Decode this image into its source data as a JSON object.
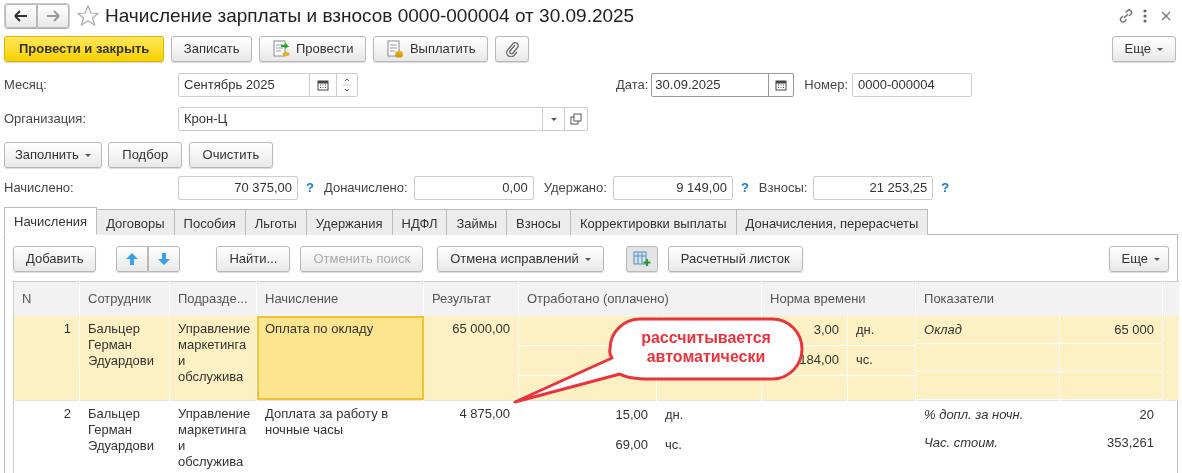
{
  "window": {
    "title": "Начисление зарплаты и взносов 0000-000004 от 30.09.2025",
    "favorite": false
  },
  "toolbar": {
    "buttons": [
      {
        "label": "Провести и закрыть",
        "kind": "primary"
      },
      {
        "label": "Записать",
        "kind": "plain"
      },
      {
        "label": "Провести",
        "kind": "post"
      },
      {
        "label": "Выплатить",
        "kind": "pay"
      },
      {
        "kind": "attach"
      }
    ],
    "more": "Еще"
  },
  "header": {
    "month": {
      "label": "Месяц:",
      "value": "Сентябрь 2025"
    },
    "date": {
      "label": "Дата:",
      "value": "30.09.2025"
    },
    "number": {
      "label": "Номер:",
      "value": "0000-000004"
    },
    "organization": {
      "label": "Организация:",
      "value": "Крон-Ц"
    }
  },
  "fill_buttons": [
    {
      "label": "Заполнить",
      "dropdown": true
    },
    {
      "label": "Подбор",
      "dropdown": false
    },
    {
      "label": "Очистить",
      "dropdown": false
    }
  ],
  "totals": [
    {
      "label": "Начислено:",
      "value": "70 375,00",
      "help": "?"
    },
    {
      "label": "Доначислено:",
      "value": "0,00"
    },
    {
      "label": "Удержано:",
      "value": "9 149,00",
      "help": "?"
    },
    {
      "label": "Взносы:",
      "value": "21 253,25",
      "help": "?"
    }
  ],
  "tabs": [
    {
      "label": "Начисления",
      "selected": true
    },
    {
      "label": "Договоры",
      "selected": false
    },
    {
      "label": "Пособия",
      "selected": false
    },
    {
      "label": "Льготы",
      "selected": false
    },
    {
      "label": "Удержания",
      "selected": false
    },
    {
      "label": "НДФЛ",
      "selected": false
    },
    {
      "label": "Займы",
      "selected": false
    },
    {
      "label": "Взносы",
      "selected": false
    },
    {
      "label": "Корректировки выплаты",
      "selected": false
    },
    {
      "label": "Доначисления, перерасчеты",
      "selected": false
    }
  ],
  "table_toolbar": {
    "buttons": [
      {
        "kind": "text",
        "label": "Добавить",
        "disabled": false
      },
      {
        "kind": "up"
      },
      {
        "kind": "down"
      },
      {
        "kind": "text",
        "label": "Найти...",
        "disabled": false
      },
      {
        "kind": "text",
        "label": "Отменить поиск",
        "disabled": true
      },
      {
        "kind": "text",
        "label": "Отмена исправлений",
        "disabled": false,
        "dropdown": true
      },
      {
        "kind": "grid"
      },
      {
        "kind": "text",
        "label": "Расчетный листок",
        "disabled": false
      }
    ],
    "more": "Еще"
  },
  "table": {
    "columns": [
      "N",
      "Сотрудник",
      "Подразде...",
      "Начисление",
      "Результат",
      "Отработано (оплачено)",
      "Норма времени",
      "Показатели"
    ],
    "rows": [
      {
        "n": "1",
        "employee": "Бальцер Герман Эдуардови",
        "department": "Управление маркетинга и обслужива",
        "accrual": "Оплата по окладу",
        "accrual_focused": true,
        "result": "65 000,00",
        "selected": true,
        "worked": [],
        "norm": [
          {
            "value": "3,00",
            "unit": "дн."
          },
          {
            "value": "184,00",
            "unit": "чс."
          }
        ],
        "indicators": [
          {
            "name": "Оклад",
            "value": "65 000"
          }
        ]
      },
      {
        "n": "2",
        "employee": "Бальцер Герман Эдуардови",
        "department": "Управление маркетинга и обслужива",
        "accrual": "Доплата за работу в ночные часы",
        "accrual_focused": false,
        "result": "4 875,00",
        "selected": false,
        "worked": [
          {
            "value": "15,00",
            "unit": "дн."
          },
          {
            "value": "69,00",
            "unit": "чс."
          }
        ],
        "norm": [],
        "indicators": [
          {
            "name": "% допл. за ночн.",
            "value": "20"
          },
          {
            "name": "Час. стоим.",
            "value": "353,261"
          }
        ]
      }
    ]
  },
  "callout": {
    "text": "рассчитывается автоматически"
  }
}
